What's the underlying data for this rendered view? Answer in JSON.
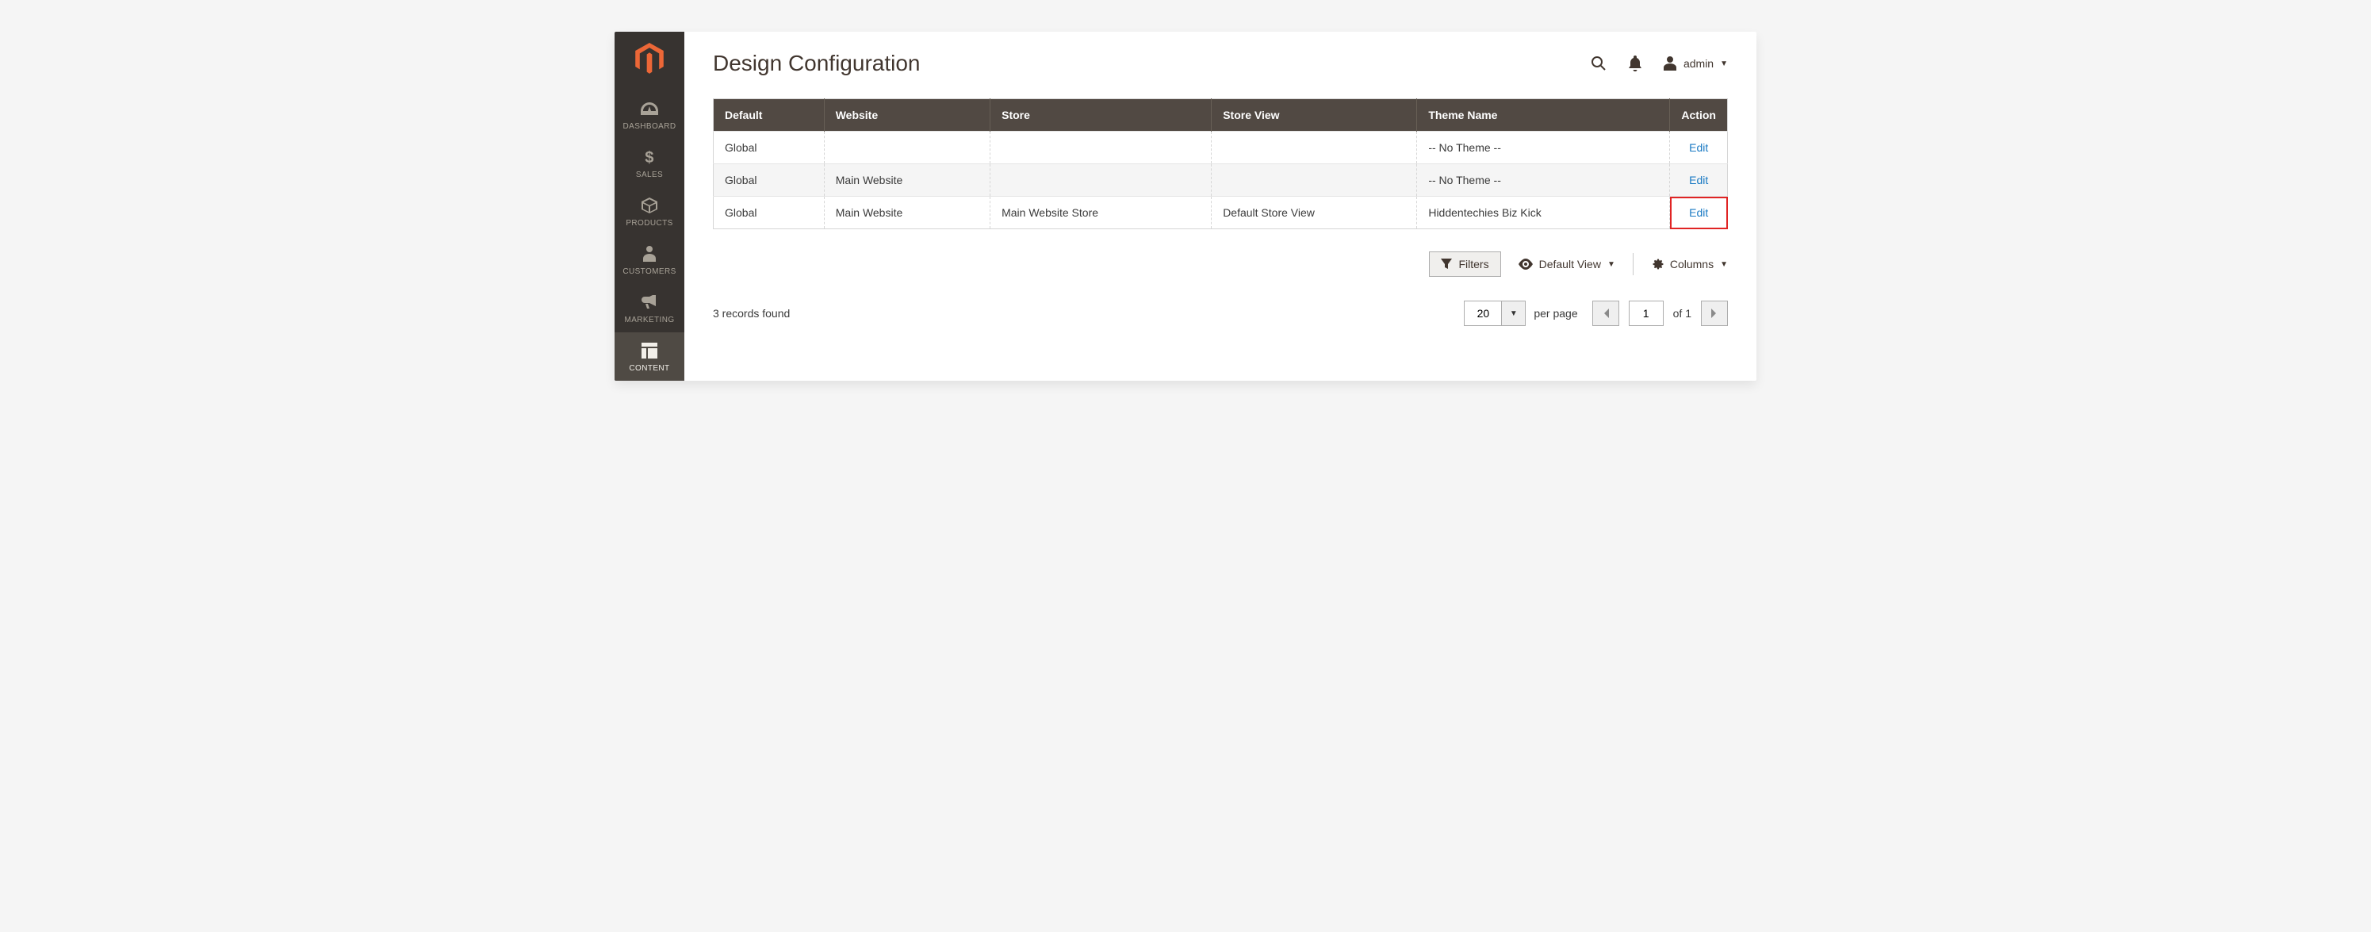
{
  "user": {
    "name": "admin"
  },
  "page": {
    "title": "Design Configuration"
  },
  "sidebar": {
    "items": [
      {
        "label": "DASHBOARD",
        "icon": "dashboard"
      },
      {
        "label": "SALES",
        "icon": "dollar"
      },
      {
        "label": "PRODUCTS",
        "icon": "box"
      },
      {
        "label": "CUSTOMERS",
        "icon": "person"
      },
      {
        "label": "MARKETING",
        "icon": "megaphone"
      },
      {
        "label": "CONTENT",
        "icon": "layout",
        "active": true
      }
    ]
  },
  "table": {
    "columns": [
      "Default",
      "Website",
      "Store",
      "Store View",
      "Theme Name",
      "Action"
    ],
    "rows": [
      {
        "default": "Global",
        "website": "",
        "store": "",
        "store_view": "",
        "theme": "-- No Theme --",
        "action": "Edit"
      },
      {
        "default": "Global",
        "website": "Main Website",
        "store": "",
        "store_view": "",
        "theme": "-- No Theme --",
        "action": "Edit"
      },
      {
        "default": "Global",
        "website": "Main Website",
        "store": "Main Website Store",
        "store_view": "Default Store View",
        "theme": "Hiddentechies Biz Kick",
        "action": "Edit",
        "highlight_action": true
      }
    ]
  },
  "toolbar": {
    "filters_label": "Filters",
    "view_label": "Default View",
    "columns_label": "Columns"
  },
  "footer": {
    "records_found": "3 records found",
    "page_size": "20",
    "per_page_label": "per page",
    "current_page": "1",
    "of_label": "of 1"
  }
}
